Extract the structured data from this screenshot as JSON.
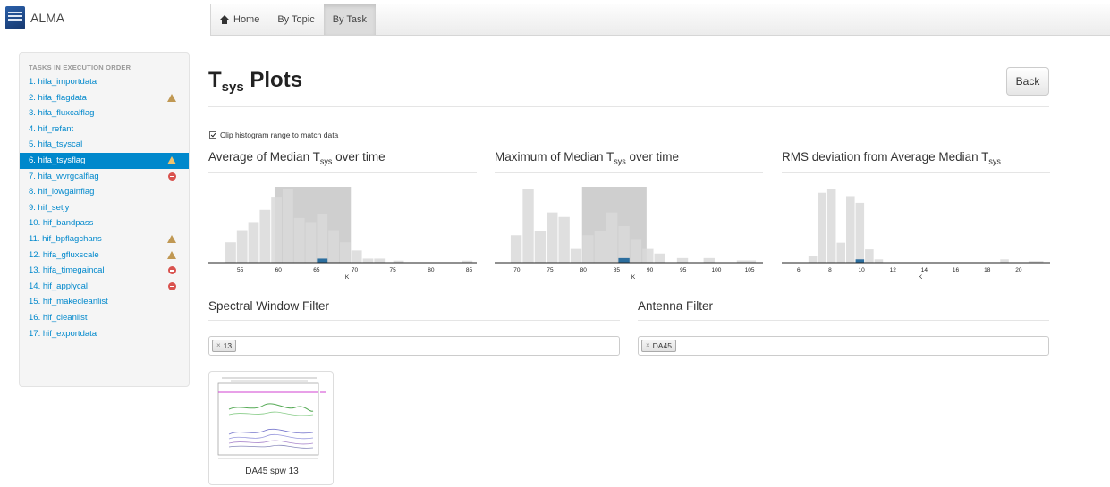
{
  "app": {
    "brand": "ALMA"
  },
  "nav": {
    "items": [
      {
        "label": "Home"
      },
      {
        "label": "By Topic"
      },
      {
        "label": "By Task"
      }
    ]
  },
  "sidebar": {
    "heading": "TASKS IN EXECUTION ORDER",
    "items": [
      {
        "label": "1. hifa_importdata",
        "status": ""
      },
      {
        "label": "2. hifa_flagdata",
        "status": "warning"
      },
      {
        "label": "3. hifa_fluxcalflag",
        "status": ""
      },
      {
        "label": "4. hif_refant",
        "status": ""
      },
      {
        "label": "5. hifa_tsyscal",
        "status": ""
      },
      {
        "label": "6. hifa_tsysflag",
        "status": "warning",
        "active": true
      },
      {
        "label": "7. hifa_wvrgcalflag",
        "status": "error"
      },
      {
        "label": "8. hif_lowgainflag",
        "status": ""
      },
      {
        "label": "9. hif_setjy",
        "status": ""
      },
      {
        "label": "10. hif_bandpass",
        "status": ""
      },
      {
        "label": "11. hif_bpflagchans",
        "status": "warning"
      },
      {
        "label": "12. hifa_gfluxscale",
        "status": "warning"
      },
      {
        "label": "13. hifa_timegaincal",
        "status": "error"
      },
      {
        "label": "14. hif_applycal",
        "status": "error"
      },
      {
        "label": "15. hif_makecleanlist",
        "status": ""
      },
      {
        "label": "16. hif_cleanlist",
        "status": ""
      },
      {
        "label": "17. hif_exportdata",
        "status": ""
      }
    ]
  },
  "page": {
    "title_main": "T",
    "title_sub": "sys",
    "title_rest": " Plots",
    "back_label": "Back"
  },
  "clip": {
    "label": "Clip histogram range to match data",
    "checked": true
  },
  "plots": [
    {
      "title_a": "Average of Median T",
      "title_sub": "sys",
      "title_b": " over time"
    },
    {
      "title_a": "Maximum of Median T",
      "title_sub": "sys",
      "title_b": " over time"
    },
    {
      "title_a": "RMS deviation from Average Median T",
      "title_sub": "sys",
      "title_b": ""
    }
  ],
  "filters": {
    "spw": {
      "title": "Spectral Window Filter",
      "tag": "13"
    },
    "antenna": {
      "title": "Antenna Filter",
      "tag": "DA45"
    }
  },
  "thumbnail": {
    "caption": "DA45 spw 13"
  },
  "colors": {
    "accent": "#0088cc",
    "warning": "#c09853",
    "error": "#d9534f",
    "bar": "#d9d9d9",
    "bar_selected": "#2c6e9e",
    "brush": "#bfbfbf"
  },
  "chart_data": [
    {
      "type": "bar",
      "xlabel": "K",
      "ticks": [
        "55",
        "60",
        "65",
        "70",
        "75",
        "80",
        "85"
      ],
      "xlim": [
        52,
        86
      ],
      "bins": [
        {
          "x0": 53.0,
          "x1": 54.5,
          "y": 5
        },
        {
          "x0": 54.5,
          "x1": 56.0,
          "y": 8
        },
        {
          "x0": 56.0,
          "x1": 57.5,
          "y": 10
        },
        {
          "x0": 57.5,
          "x1": 59.0,
          "y": 13
        },
        {
          "x0": 59.0,
          "x1": 60.5,
          "y": 16
        },
        {
          "x0": 60.5,
          "x1": 62.0,
          "y": 18
        },
        {
          "x0": 62.0,
          "x1": 63.5,
          "y": 11
        },
        {
          "x0": 63.5,
          "x1": 65.0,
          "y": 10
        },
        {
          "x0": 65.0,
          "x1": 66.5,
          "y": 12
        },
        {
          "x0": 66.5,
          "x1": 68.0,
          "y": 8
        },
        {
          "x0": 68.0,
          "x1": 69.5,
          "y": 5
        },
        {
          "x0": 69.5,
          "x1": 71.0,
          "y": 3
        },
        {
          "x0": 71.0,
          "x1": 72.5,
          "y": 1
        },
        {
          "x0": 72.5,
          "x1": 74.0,
          "y": 1
        },
        {
          "x0": 75.0,
          "x1": 76.5,
          "y": 0.5
        },
        {
          "x0": 84.0,
          "x1": 85.5,
          "y": 0.5
        }
      ],
      "selected_bin": {
        "x0": 65.0,
        "x1": 66.5,
        "y": 1
      },
      "brush": [
        59.5,
        69.5
      ]
    },
    {
      "type": "bar",
      "xlabel": "K",
      "ticks": [
        "70",
        "75",
        "80",
        "85",
        "90",
        "95",
        "100",
        "105"
      ],
      "xlim": [
        68,
        107
      ],
      "bins": [
        {
          "x0": 69.0,
          "x1": 70.8,
          "y": 6
        },
        {
          "x0": 70.8,
          "x1": 72.6,
          "y": 16
        },
        {
          "x0": 72.6,
          "x1": 74.4,
          "y": 7
        },
        {
          "x0": 74.4,
          "x1": 76.2,
          "y": 11
        },
        {
          "x0": 76.2,
          "x1": 78.0,
          "y": 10
        },
        {
          "x0": 78.0,
          "x1": 79.8,
          "y": 3
        },
        {
          "x0": 79.8,
          "x1": 81.6,
          "y": 6
        },
        {
          "x0": 81.6,
          "x1": 83.4,
          "y": 7
        },
        {
          "x0": 83.4,
          "x1": 85.2,
          "y": 11
        },
        {
          "x0": 85.2,
          "x1": 87.0,
          "y": 8
        },
        {
          "x0": 87.0,
          "x1": 88.8,
          "y": 5
        },
        {
          "x0": 88.8,
          "x1": 90.6,
          "y": 3
        },
        {
          "x0": 90.6,
          "x1": 92.4,
          "y": 2
        },
        {
          "x0": 94.0,
          "x1": 95.8,
          "y": 1
        },
        {
          "x0": 98.0,
          "x1": 99.8,
          "y": 1
        },
        {
          "x0": 103.0,
          "x1": 106.0,
          "y": 0.5
        }
      ],
      "selected_bin": {
        "x0": 85.2,
        "x1": 87.0,
        "y": 1
      },
      "brush": [
        79.8,
        89.5
      ]
    },
    {
      "type": "bar",
      "xlabel": "K",
      "ticks": [
        "6",
        "8",
        "10",
        "12",
        "14",
        "16",
        "18",
        "20"
      ],
      "xlim": [
        5.5,
        22
      ],
      "bins": [
        {
          "x0": 6.6,
          "x1": 7.2,
          "y": 2
        },
        {
          "x0": 7.2,
          "x1": 7.8,
          "y": 21
        },
        {
          "x0": 7.8,
          "x1": 8.4,
          "y": 22
        },
        {
          "x0": 8.4,
          "x1": 9.0,
          "y": 6
        },
        {
          "x0": 9.0,
          "x1": 9.6,
          "y": 20
        },
        {
          "x0": 9.6,
          "x1": 10.2,
          "y": 18
        },
        {
          "x0": 10.2,
          "x1": 10.8,
          "y": 4
        },
        {
          "x0": 10.8,
          "x1": 11.4,
          "y": 1
        },
        {
          "x0": 18.8,
          "x1": 19.4,
          "y": 1
        },
        {
          "x0": 20.6,
          "x1": 21.6,
          "y": 0.5
        }
      ],
      "selected_bin": {
        "x0": 9.6,
        "x1": 10.2,
        "y": 1
      },
      "brush": null
    }
  ]
}
